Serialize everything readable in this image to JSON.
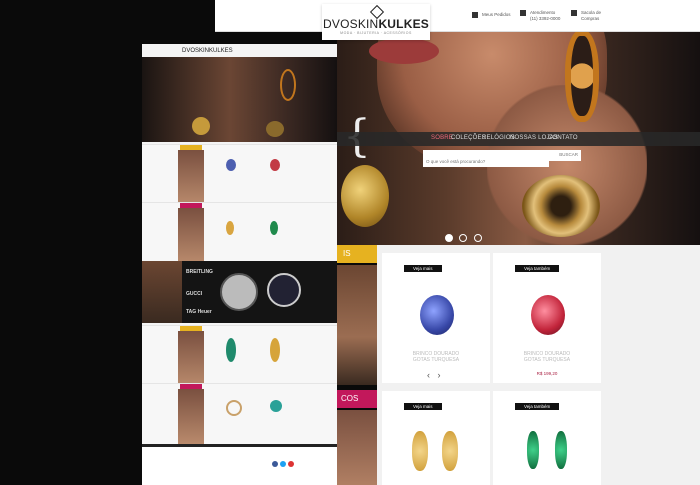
{
  "brand": {
    "name_light": "DVOSKIN",
    "name_bold": "KULKES",
    "tagline": "MODA · BIJUTERIA · ACESSÓRIOS"
  },
  "topbar": {
    "orders": "Meus Pedidos",
    "service_label": "Atendimento",
    "service_phone": "(11) 3392-0000",
    "cart_label": "Sacola de",
    "cart_label2": "Compras"
  },
  "nav": [
    "SOBRE",
    "COLEÇÕES",
    "RELÓGIOS",
    "NOSSAS LOJAS",
    "CONTATO"
  ],
  "search": {
    "placeholder": "O que você está procurando?",
    "button": "BUSCAR"
  },
  "carousel": {
    "active_index": 0,
    "count": 3
  },
  "products": [
    {
      "tag": "Veja mais",
      "name": "BRINCO DOURADO\nGOTAS TURQUESA",
      "price": ""
    },
    {
      "tag": "Veja também",
      "name": "BRINCO DOURADO\nGOTAS TURQUESA",
      "price": "R$ 199,20"
    },
    {
      "tag": "Veja mais",
      "name": "",
      "price": ""
    },
    {
      "tag": "Veja também",
      "name": "",
      "price": ""
    }
  ],
  "section_labels": {
    "first": "IS",
    "second": "COS"
  },
  "mini_preview": {
    "logo": "DVOSKINKULKES",
    "watch_brands": [
      "BREITLING",
      "GUCCI",
      "TAG Heuer"
    ]
  },
  "colors": {
    "accent_pink": "#c2185b",
    "accent_gold": "#e6b220",
    "nav_active": "#f06a7a"
  }
}
